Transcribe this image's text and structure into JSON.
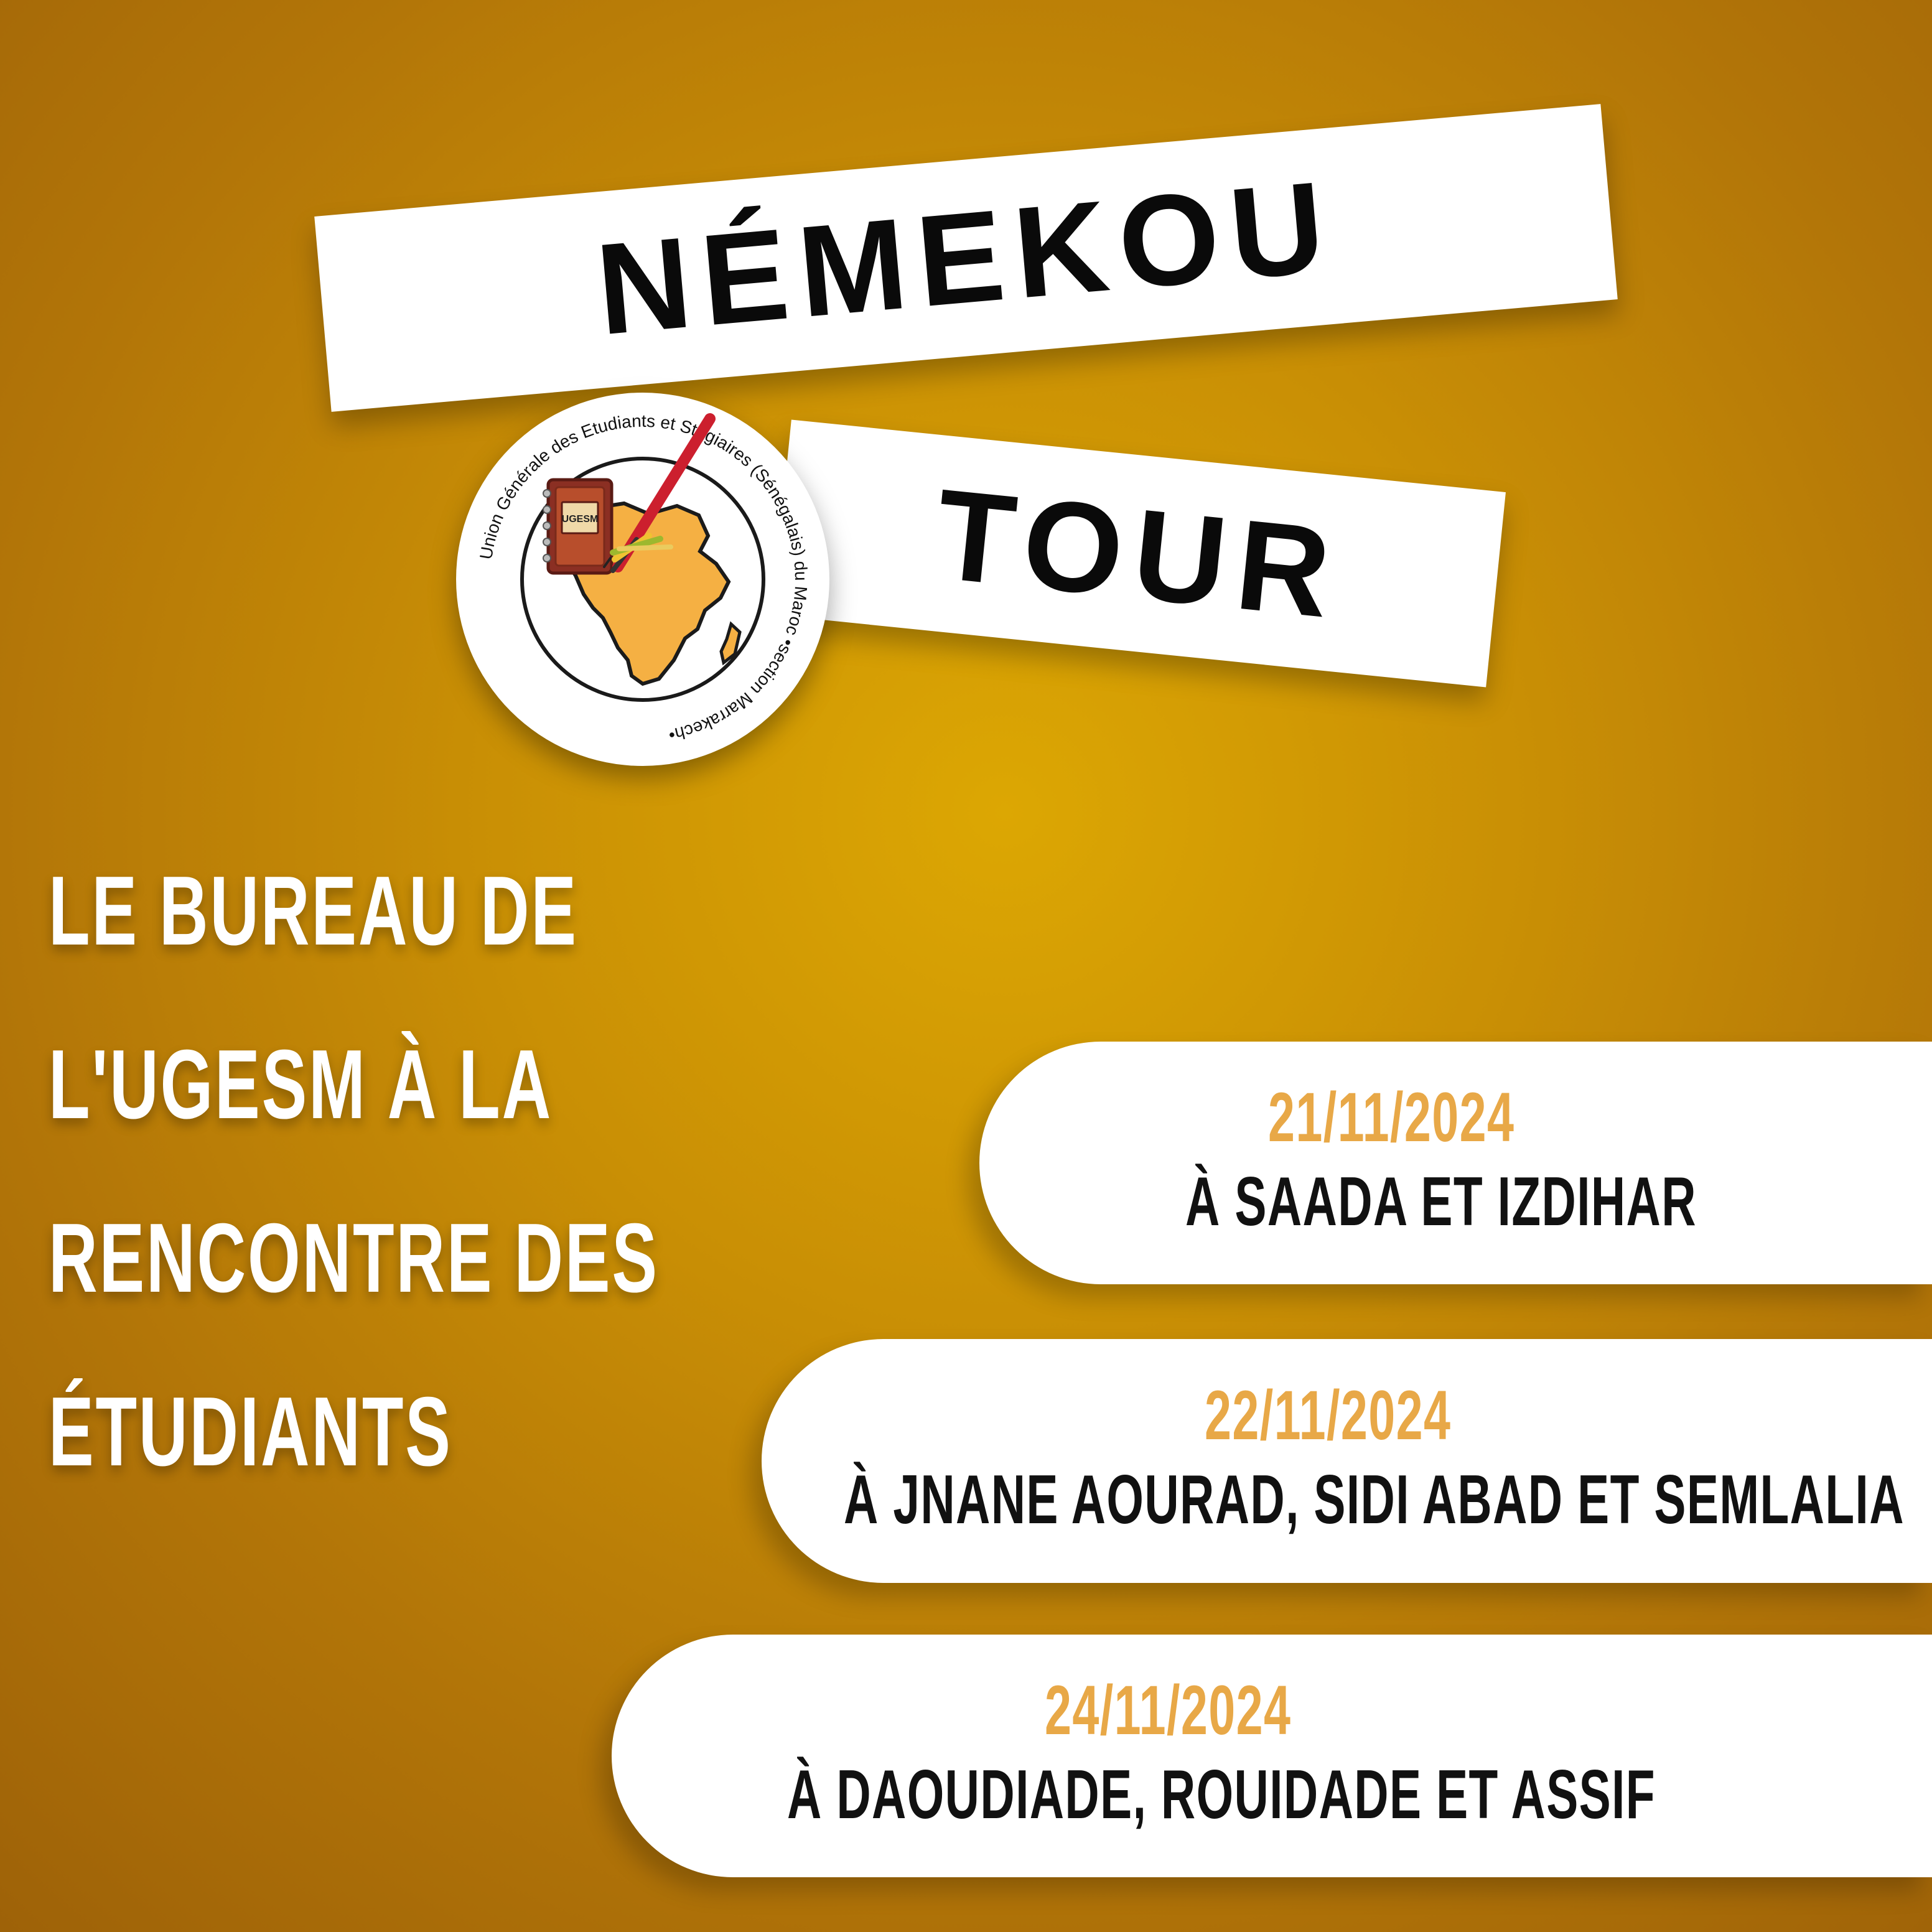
{
  "title": {
    "line1": "NÉMEKOU",
    "line2": "TOUR"
  },
  "logo": {
    "book_label": "UGESM",
    "ring_text": "Union Générale des Etudiants et Stagiaires (Sénégalais) du Maroc •section Marrakech•"
  },
  "headline": {
    "line1": "LE BUREAU DE",
    "line2": "L'UGESM À LA",
    "line3": "RENCONTRE DES",
    "line4": "ÉTUDIANTS"
  },
  "events": [
    {
      "date": "21/11/2024",
      "place": "À SAADA ET IZDIHAR"
    },
    {
      "date": "22/11/2024",
      "place": "À JNANE AOURAD, SIDI ABAD ET SEMLALIA"
    },
    {
      "date": "24/11/2024",
      "place": "À DAOUDIADE, ROUIDADE ET ASSIF"
    }
  ],
  "colors": {
    "background": "#C98F05",
    "accent_date": "#E8A847",
    "title_text": "#0A0A0A",
    "panel": "#FFFFFF"
  },
  "icons": {
    "logo_book": "book-icon",
    "logo_pen": "pen-icon",
    "logo_map": "africa-map-icon"
  }
}
